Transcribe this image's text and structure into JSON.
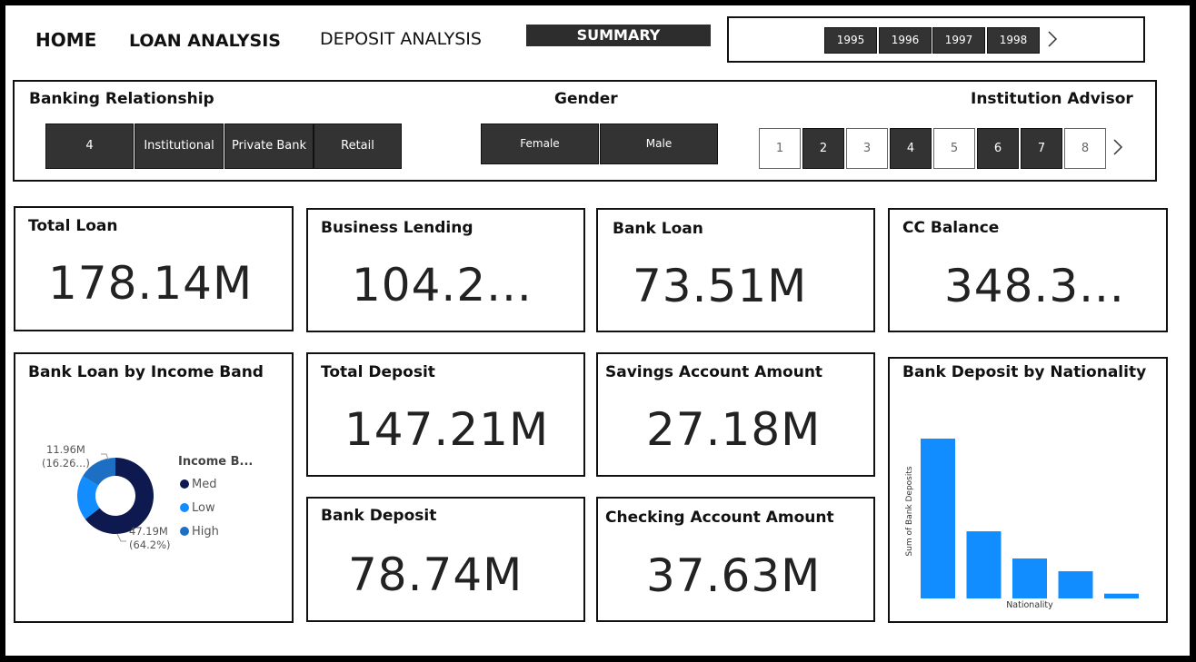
{
  "nav": {
    "home": "HOME",
    "loan_analysis": "LOAN ANALYSIS",
    "deposit_analysis": "DEPOSIT ANALYSIS",
    "summary": "SUMMARY"
  },
  "years": {
    "items": [
      "1995",
      "1996",
      "1997",
      "1998"
    ],
    "next_icon": "chevron-right-icon"
  },
  "slicers": {
    "banking_relationship": {
      "title": "Banking Relationship",
      "options": [
        "4",
        "Institutional",
        "Private Bank",
        "Retail"
      ]
    },
    "gender": {
      "title": "Gender",
      "options": [
        "Female",
        "Male"
      ]
    },
    "institution_advisor": {
      "title": "Institution Advisor",
      "options": [
        "1",
        "2",
        "3",
        "4",
        "5",
        "6",
        "7",
        "8"
      ],
      "selected": [
        false,
        true,
        false,
        true,
        false,
        true,
        true,
        false
      ],
      "next_icon": "chevron-right-icon"
    }
  },
  "kpis": {
    "total_loan": {
      "title": "Total Loan",
      "value": "178.14M"
    },
    "business_lending": {
      "title": "Business Lending",
      "value": "104.2..."
    },
    "bank_loan": {
      "title": "Bank Loan",
      "value": "73.51M"
    },
    "cc_balance": {
      "title": "CC Balance",
      "value": "348.3..."
    },
    "total_deposit": {
      "title": "Total Deposit",
      "value": "147.21M"
    },
    "savings_amount": {
      "title": "Savings Account Amount",
      "value": "27.18M"
    },
    "bank_deposit": {
      "title": "Bank Deposit",
      "value": "78.74M"
    },
    "checking_amount": {
      "title": "Checking Account Amount",
      "value": "37.63M"
    }
  },
  "colors": {
    "dark_navy": "#0e1a4f",
    "bright_blue": "#118dff",
    "mid_blue": "#1c6fc3",
    "button_dark": "#333333"
  },
  "chart_data": [
    {
      "type": "pie",
      "title": "Bank Loan by Income Band",
      "legend_title": "Income B...",
      "legend_position": "right",
      "labels": [
        "Med",
        "Low",
        "High"
      ],
      "values": [
        47.19,
        14.04,
        11.96
      ],
      "colors": [
        "#0e1a4f",
        "#118dff",
        "#1c6fc3"
      ],
      "data_labels": {
        "med": {
          "value": "47.19M",
          "pct": "(64.2%)"
        },
        "high": {
          "value": "11.96M",
          "pct": "(16.26...)"
        }
      }
    },
    {
      "type": "bar",
      "title": "Bank Deposit by Nationality",
      "xlabel": "Nationality",
      "ylabel": "Sum of Bank Deposits",
      "values": [
        100,
        42,
        25,
        17,
        3
      ],
      "color": "#118dff"
    }
  ]
}
